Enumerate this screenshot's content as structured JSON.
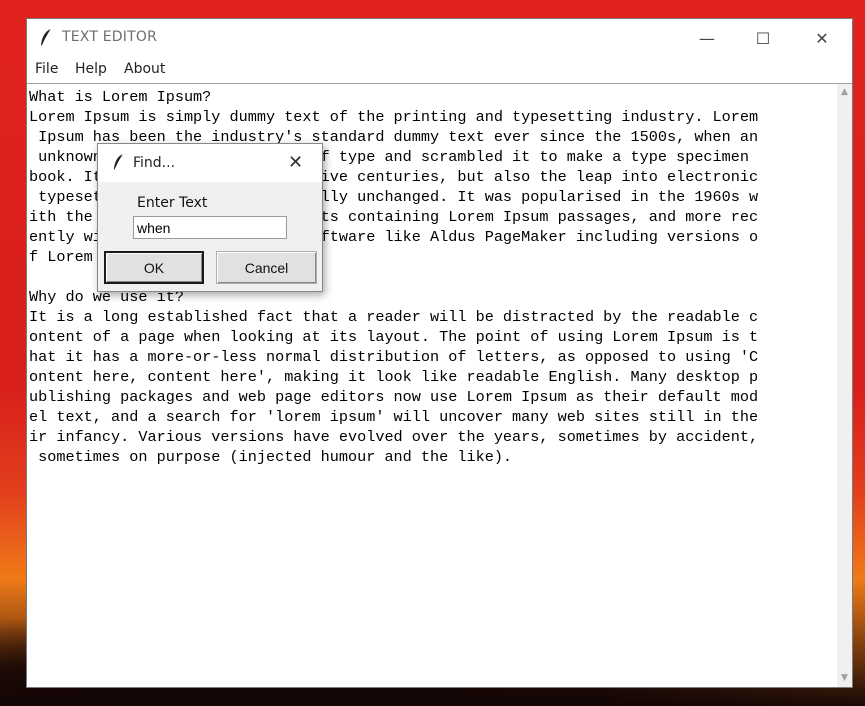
{
  "window": {
    "title": "TEXT EDITOR",
    "minimize": "—",
    "maximize": "☐",
    "close": "✕"
  },
  "menu": {
    "file": "File",
    "help": "Help",
    "about": "About"
  },
  "editor": {
    "lines": [
      "What is Lorem Ipsum?",
      "Lorem Ipsum is simply dummy text of the printing and typesetting industry. Lorem",
      " Ipsum has been the industry's standard dummy text ever since the 1500s, when an",
      " unknown printer took a galley of type and scrambled it to make a type specimen",
      "book. It has survived not only five centuries, but also the leap into electronic",
      " typesetting, remaining essentially unchanged. It was popularised in the 1960s w",
      "ith the release of Letraset sheets containing Lorem Ipsum passages, and more rec",
      "ently with desktop publishing software like Aldus PageMaker including versions o",
      "f Lorem Ipsum.",
      "",
      "Why do we use it?",
      "It is a long established fact that a reader will be distracted by the readable c",
      "ontent of a page when looking at its layout. The point of using Lorem Ipsum is t",
      "hat it has a more-or-less normal distribution of letters, as opposed to using 'C",
      "ontent here, content here', making it look like readable English. Many desktop p",
      "ublishing packages and web page editors now use Lorem Ipsum as their default mod",
      "el text, and a search for 'lorem ipsum' will uncover many web sites still in the",
      "ir infancy. Various versions have evolved over the years, sometimes by accident,",
      " sometimes on purpose (injected humour and the like)."
    ]
  },
  "find_dialog": {
    "title": "Find...",
    "close": "✕",
    "label": "Enter Text",
    "value": "when",
    "ok": "OK",
    "cancel": "Cancel"
  },
  "icons": {
    "app": "feather-icon",
    "dialog": "feather-icon"
  },
  "colors": {
    "desktop": "#e0231f"
  }
}
